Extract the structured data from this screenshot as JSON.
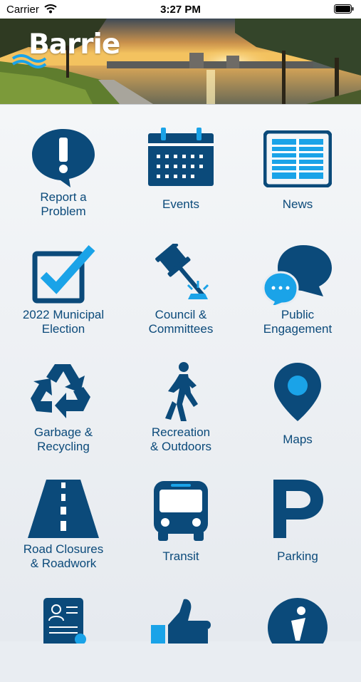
{
  "status_bar": {
    "carrier": "Carrier",
    "time": "3:27 PM"
  },
  "header": {
    "logo_text": "Barrie"
  },
  "tiles": [
    {
      "label": "Report a\nProblem",
      "icon": "exclamation-bubble-icon"
    },
    {
      "label": "Events",
      "icon": "calendar-icon"
    },
    {
      "label": "News",
      "icon": "newspaper-icon"
    },
    {
      "label": "2022 Municipal\nElection",
      "icon": "checkbox-icon"
    },
    {
      "label": "Council &\nCommittees",
      "icon": "gavel-icon"
    },
    {
      "label": "Public\nEngagement",
      "icon": "chat-bubbles-icon"
    },
    {
      "label": "Garbage &\nRecycling",
      "icon": "recycle-icon"
    },
    {
      "label": "Recreation\n& Outdoors",
      "icon": "walking-person-icon"
    },
    {
      "label": "Maps",
      "icon": "map-pin-icon"
    },
    {
      "label": "Road Closures\n& Roadwork",
      "icon": "road-icon"
    },
    {
      "label": "Transit",
      "icon": "bus-icon"
    },
    {
      "label": "Parking",
      "icon": "parking-icon"
    },
    {
      "label": "",
      "icon": "id-card-icon"
    },
    {
      "label": "",
      "icon": "thumbs-up-icon"
    },
    {
      "label": "",
      "icon": "info-icon"
    }
  ],
  "colors": {
    "brand": "#0b4a7a",
    "accent": "#1aa3e8"
  }
}
